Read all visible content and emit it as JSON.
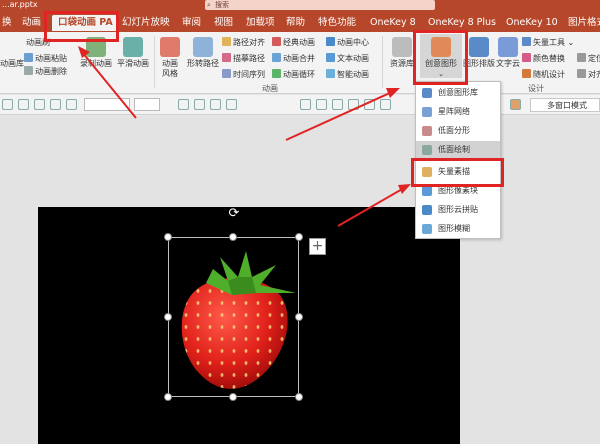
{
  "titlebar": {
    "filename": "...ar.pptx",
    "search_placeholder": "搜索"
  },
  "tabs": [
    "换",
    "动画",
    "口袋动画 PA",
    "幻灯片放映",
    "审阅",
    "视图",
    "加载项",
    "帮助",
    "特色功能",
    "OneKey 8",
    "OneKey 8 Plus",
    "OneKey 10",
    "图片格式"
  ],
  "ribbon": {
    "left": {
      "lib": "动画库",
      "paste": "动画粘贴",
      "del": "动画删除",
      "top": "动画刷",
      "record": "录制动画",
      "smooth": "平滑动画"
    },
    "anim": {
      "style": "动画\n风格",
      "path": "形转路径",
      "align": "路径对齐",
      "capture": "描摹路径",
      "seq": "时间序列",
      "classic": "经典动画",
      "merge": "动画合并",
      "loop": "动画循环",
      "center": "动画中心",
      "text": "文本动画",
      "smart": "智能动画",
      "group": "动画"
    },
    "design": {
      "res": "资源库",
      "creative": "创意图形",
      "layout": "图形排版",
      "textcloud": "文字云",
      "vector": "矢量工具",
      "color": "颜色替换",
      "random": "随机设计",
      "locate": "定位",
      "align": "对齐",
      "group": "设计"
    }
  },
  "strip": {
    "window_mode": "多窗口模式"
  },
  "dropdown": [
    "创意图形库",
    "星阵网络",
    "低面分形",
    "低面绘制",
    "矢量素描",
    "图形像素块",
    "图形云拼贴",
    "图形模糊"
  ],
  "colors": {
    "accent": "#b7472a",
    "annotation": "#e02424"
  }
}
